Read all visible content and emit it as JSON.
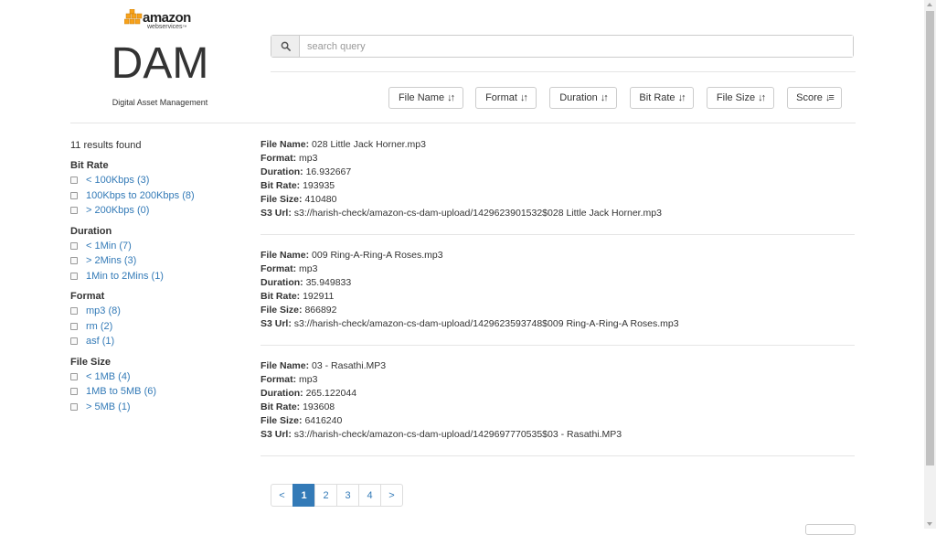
{
  "logo": {
    "brand": "amazon",
    "sub": "webservices",
    "tm": "™"
  },
  "header": {
    "title": "DAM",
    "subtitle": "Digital Asset Management"
  },
  "search": {
    "placeholder": "search query",
    "value": ""
  },
  "sort_buttons": [
    {
      "label": "File Name",
      "icon": "sort-arrows-icon",
      "glyph": "↓↑"
    },
    {
      "label": "Format",
      "icon": "sort-arrows-icon",
      "glyph": "↓↑"
    },
    {
      "label": "Duration",
      "icon": "sort-arrows-icon",
      "glyph": "↓↑"
    },
    {
      "label": "Bit Rate",
      "icon": "sort-arrows-icon",
      "glyph": "↓↑"
    },
    {
      "label": "File Size",
      "icon": "sort-arrows-icon",
      "glyph": "↓↑"
    },
    {
      "label": "Score",
      "icon": "sort-descending-icon",
      "glyph": "↓≡"
    }
  ],
  "sidebar": {
    "results_count": "11 results found",
    "facets": [
      {
        "title": "Bit Rate",
        "items": [
          "< 100Kbps (3)",
          "100Kbps to 200Kbps (8)",
          "> 200Kbps (0)"
        ]
      },
      {
        "title": "Duration",
        "items": [
          "< 1Min (7)",
          "> 2Mins (3)",
          "1Min to 2Mins (1)"
        ]
      },
      {
        "title": "Format",
        "items": [
          "mp3 (8)",
          "rm (2)",
          "asf (1)"
        ]
      },
      {
        "title": "File Size",
        "items": [
          "< 1MB (4)",
          "1MB to 5MB (6)",
          "> 5MB (1)"
        ]
      }
    ]
  },
  "field_labels": {
    "file_name": "File Name:",
    "format": "Format:",
    "duration": "Duration:",
    "bit_rate": "Bit Rate:",
    "file_size": "File Size:",
    "s3_url": "S3 Url:"
  },
  "results": [
    {
      "file_name": "028 Little Jack Horner.mp3",
      "format": "mp3",
      "duration": "16.932667",
      "bit_rate": "193935",
      "file_size": "410480",
      "s3_url": "s3://harish-check/amazon-cs-dam-upload/1429623901532$028 Little Jack Horner.mp3"
    },
    {
      "file_name": "009 Ring-A-Ring-A Roses.mp3",
      "format": "mp3",
      "duration": "35.949833",
      "bit_rate": "192911",
      "file_size": "866892",
      "s3_url": "s3://harish-check/amazon-cs-dam-upload/1429623593748$009 Ring-A-Ring-A Roses.mp3"
    },
    {
      "file_name": "03 - Rasathi.MP3",
      "format": "mp3",
      "duration": "265.122044",
      "bit_rate": "193608",
      "file_size": "6416240",
      "s3_url": "s3://harish-check/amazon-cs-dam-upload/1429697770535$03 - Rasathi.MP3"
    }
  ],
  "pagination": {
    "prev": "<",
    "pages": [
      "1",
      "2",
      "3",
      "4"
    ],
    "next": ">",
    "current": "1"
  },
  "colors": {
    "link": "#337ab7",
    "active_page": "#337ab7",
    "aws_orange": "#f7a21b"
  }
}
